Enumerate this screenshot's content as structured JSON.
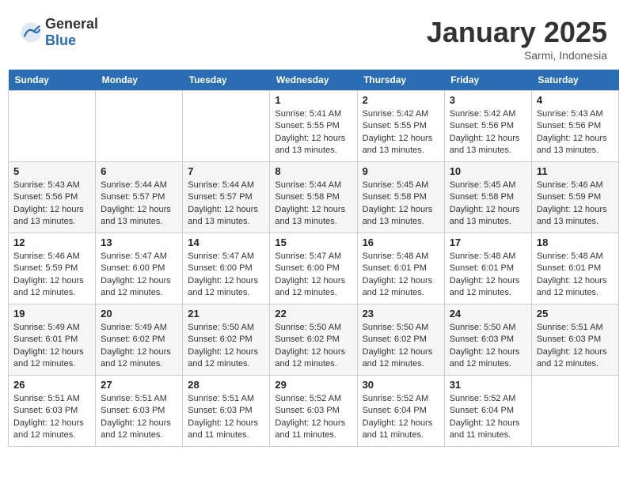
{
  "header": {
    "logo_general": "General",
    "logo_blue": "Blue",
    "month": "January 2025",
    "location": "Sarmi, Indonesia"
  },
  "weekdays": [
    "Sunday",
    "Monday",
    "Tuesday",
    "Wednesday",
    "Thursday",
    "Friday",
    "Saturday"
  ],
  "weeks": [
    [
      {
        "day": "",
        "info": ""
      },
      {
        "day": "",
        "info": ""
      },
      {
        "day": "",
        "info": ""
      },
      {
        "day": "1",
        "info": "Sunrise: 5:41 AM\nSunset: 5:55 PM\nDaylight: 12 hours\nand 13 minutes."
      },
      {
        "day": "2",
        "info": "Sunrise: 5:42 AM\nSunset: 5:55 PM\nDaylight: 12 hours\nand 13 minutes."
      },
      {
        "day": "3",
        "info": "Sunrise: 5:42 AM\nSunset: 5:56 PM\nDaylight: 12 hours\nand 13 minutes."
      },
      {
        "day": "4",
        "info": "Sunrise: 5:43 AM\nSunset: 5:56 PM\nDaylight: 12 hours\nand 13 minutes."
      }
    ],
    [
      {
        "day": "5",
        "info": "Sunrise: 5:43 AM\nSunset: 5:56 PM\nDaylight: 12 hours\nand 13 minutes."
      },
      {
        "day": "6",
        "info": "Sunrise: 5:44 AM\nSunset: 5:57 PM\nDaylight: 12 hours\nand 13 minutes."
      },
      {
        "day": "7",
        "info": "Sunrise: 5:44 AM\nSunset: 5:57 PM\nDaylight: 12 hours\nand 13 minutes."
      },
      {
        "day": "8",
        "info": "Sunrise: 5:44 AM\nSunset: 5:58 PM\nDaylight: 12 hours\nand 13 minutes."
      },
      {
        "day": "9",
        "info": "Sunrise: 5:45 AM\nSunset: 5:58 PM\nDaylight: 12 hours\nand 13 minutes."
      },
      {
        "day": "10",
        "info": "Sunrise: 5:45 AM\nSunset: 5:58 PM\nDaylight: 12 hours\nand 13 minutes."
      },
      {
        "day": "11",
        "info": "Sunrise: 5:46 AM\nSunset: 5:59 PM\nDaylight: 12 hours\nand 13 minutes."
      }
    ],
    [
      {
        "day": "12",
        "info": "Sunrise: 5:46 AM\nSunset: 5:59 PM\nDaylight: 12 hours\nand 12 minutes."
      },
      {
        "day": "13",
        "info": "Sunrise: 5:47 AM\nSunset: 6:00 PM\nDaylight: 12 hours\nand 12 minutes."
      },
      {
        "day": "14",
        "info": "Sunrise: 5:47 AM\nSunset: 6:00 PM\nDaylight: 12 hours\nand 12 minutes."
      },
      {
        "day": "15",
        "info": "Sunrise: 5:47 AM\nSunset: 6:00 PM\nDaylight: 12 hours\nand 12 minutes."
      },
      {
        "day": "16",
        "info": "Sunrise: 5:48 AM\nSunset: 6:01 PM\nDaylight: 12 hours\nand 12 minutes."
      },
      {
        "day": "17",
        "info": "Sunrise: 5:48 AM\nSunset: 6:01 PM\nDaylight: 12 hours\nand 12 minutes."
      },
      {
        "day": "18",
        "info": "Sunrise: 5:48 AM\nSunset: 6:01 PM\nDaylight: 12 hours\nand 12 minutes."
      }
    ],
    [
      {
        "day": "19",
        "info": "Sunrise: 5:49 AM\nSunset: 6:01 PM\nDaylight: 12 hours\nand 12 minutes."
      },
      {
        "day": "20",
        "info": "Sunrise: 5:49 AM\nSunset: 6:02 PM\nDaylight: 12 hours\nand 12 minutes."
      },
      {
        "day": "21",
        "info": "Sunrise: 5:50 AM\nSunset: 6:02 PM\nDaylight: 12 hours\nand 12 minutes."
      },
      {
        "day": "22",
        "info": "Sunrise: 5:50 AM\nSunset: 6:02 PM\nDaylight: 12 hours\nand 12 minutes."
      },
      {
        "day": "23",
        "info": "Sunrise: 5:50 AM\nSunset: 6:02 PM\nDaylight: 12 hours\nand 12 minutes."
      },
      {
        "day": "24",
        "info": "Sunrise: 5:50 AM\nSunset: 6:03 PM\nDaylight: 12 hours\nand 12 minutes."
      },
      {
        "day": "25",
        "info": "Sunrise: 5:51 AM\nSunset: 6:03 PM\nDaylight: 12 hours\nand 12 minutes."
      }
    ],
    [
      {
        "day": "26",
        "info": "Sunrise: 5:51 AM\nSunset: 6:03 PM\nDaylight: 12 hours\nand 12 minutes."
      },
      {
        "day": "27",
        "info": "Sunrise: 5:51 AM\nSunset: 6:03 PM\nDaylight: 12 hours\nand 12 minutes."
      },
      {
        "day": "28",
        "info": "Sunrise: 5:51 AM\nSunset: 6:03 PM\nDaylight: 12 hours\nand 11 minutes."
      },
      {
        "day": "29",
        "info": "Sunrise: 5:52 AM\nSunset: 6:03 PM\nDaylight: 12 hours\nand 11 minutes."
      },
      {
        "day": "30",
        "info": "Sunrise: 5:52 AM\nSunset: 6:04 PM\nDaylight: 12 hours\nand 11 minutes."
      },
      {
        "day": "31",
        "info": "Sunrise: 5:52 AM\nSunset: 6:04 PM\nDaylight: 12 hours\nand 11 minutes."
      },
      {
        "day": "",
        "info": ""
      }
    ]
  ]
}
